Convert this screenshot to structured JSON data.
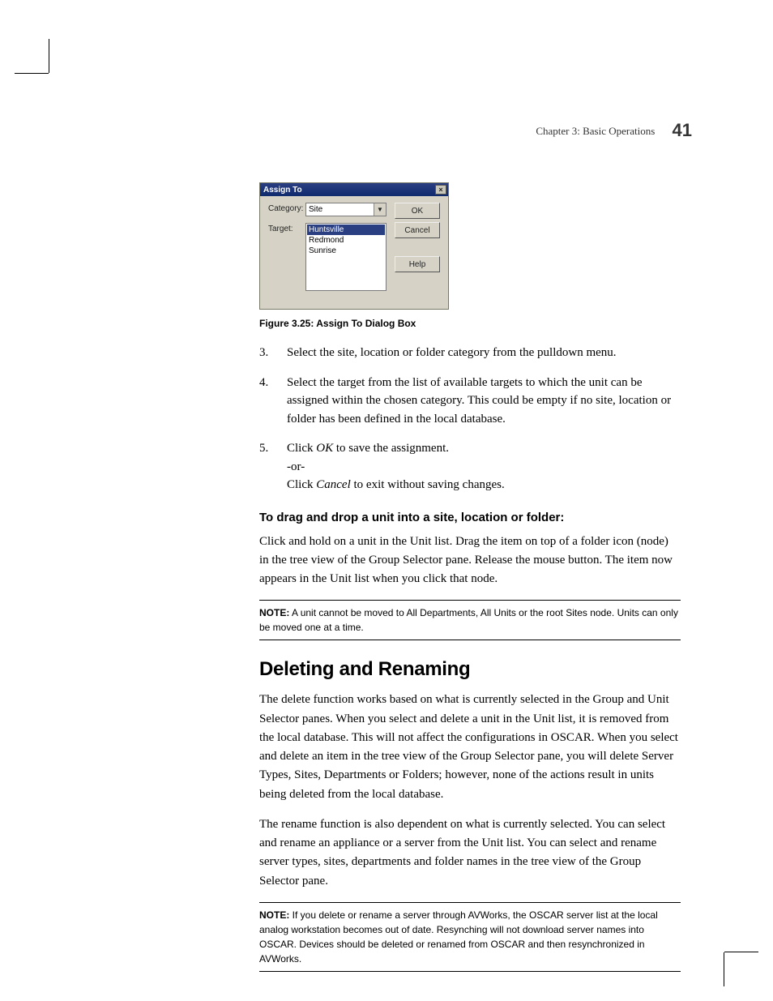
{
  "header": {
    "chapter": "Chapter 3: Basic Operations",
    "page_number": "41"
  },
  "dialog": {
    "title": "Assign To",
    "category_label": "Category:",
    "category_value": "Site",
    "target_label": "Target:",
    "target_items": [
      "Huntsville",
      "Redmond",
      "Sunrise"
    ],
    "buttons": {
      "ok": "OK",
      "cancel": "Cancel",
      "help": "Help"
    }
  },
  "figure_caption": "Figure 3.25: Assign To Dialog Box",
  "steps": {
    "s3": {
      "num": "3.",
      "text": "Select the site, location or folder category from the pulldown menu."
    },
    "s4": {
      "num": "4.",
      "text": "Select the target from the list of available targets to which the unit can be assigned within the chosen category. This could be empty if no site, location or folder has been defined in the local database."
    },
    "s5": {
      "num": "5.",
      "line1_pre": "Click ",
      "line1_em": "OK",
      "line1_post": " to save the assignment.",
      "line2": "-or-",
      "line3_pre": "Click ",
      "line3_em": "Cancel",
      "line3_post": " to exit without saving changes."
    }
  },
  "subhead_dragdrop": "To drag and drop a unit into a site, location or folder:",
  "para_dragdrop": "Click and hold on a unit in the Unit list. Drag the item on top of a folder icon (node) in the tree view of the Group Selector pane. Release the mouse button. The item now appears in the Unit list when you click that node.",
  "note1": {
    "label": "NOTE:",
    "text": " A unit cannot be moved to All Departments, All Units or the root Sites node. Units can only be moved one at a time."
  },
  "section_heading": "Deleting and Renaming",
  "para_del": "The delete function works based on what is currently selected in the Group and Unit Selector panes. When you select and delete a unit in the Unit list, it is removed from the local database. This will not affect the configurations in OSCAR. When you select and delete an item in the tree view of the Group Selector pane, you will delete Server Types, Sites, Departments or Folders; however, none of the actions result in units being deleted from the local database.",
  "para_ren": "The rename function is also dependent on what is currently selected. You can select and rename an appliance or a server from the Unit list. You can select and rename server types, sites, departments and folder names in the tree view of the Group Selector pane.",
  "note2": {
    "label": "NOTE:",
    "text": " If you delete or rename a server through AVWorks, the OSCAR server list at the local analog workstation becomes out of date. Resynching will not download server names into OSCAR. Devices should be deleted or renamed from OSCAR and then resynchronized in AVWorks."
  }
}
